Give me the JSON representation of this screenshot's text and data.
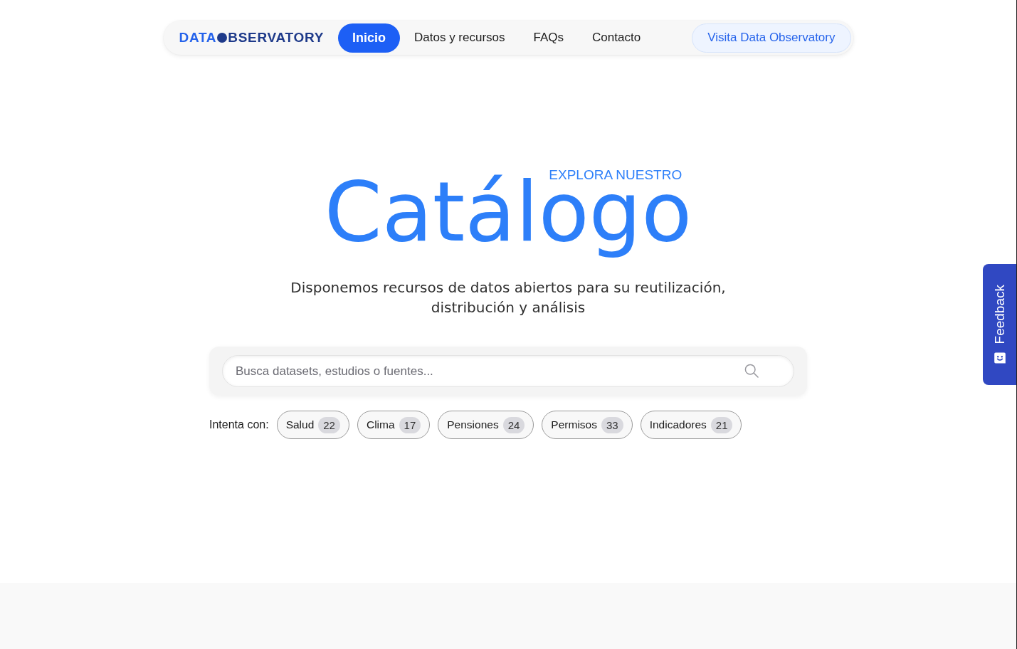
{
  "nav": {
    "logo": {
      "lead": "DATA",
      "rest": "BSERVATORY"
    },
    "items": [
      {
        "label": "Inicio",
        "selected": true
      },
      {
        "label": "Datos y recursos",
        "selected": false
      },
      {
        "label": "FAQs",
        "selected": false
      },
      {
        "label": "Contacto",
        "selected": false
      }
    ],
    "cta": "Visita Data Observatory"
  },
  "hero": {
    "eyebrow": "EXPLORA NUESTRO",
    "title": "Catálogo",
    "subtitle": "Disponemos recursos de datos abiertos para su reutilización, distribución y análisis"
  },
  "search": {
    "placeholder": "Busca datasets, estudios o fuentes..."
  },
  "suggestions": {
    "label": "Intenta con:",
    "chips": [
      {
        "label": "Salud",
        "count": "22"
      },
      {
        "label": "Clima",
        "count": "17"
      },
      {
        "label": "Pensiones",
        "count": "24"
      },
      {
        "label": "Permisos",
        "count": "33"
      },
      {
        "label": "Indicadores",
        "count": "21"
      }
    ]
  },
  "feedback_tab": {
    "label": "Feedback"
  }
}
